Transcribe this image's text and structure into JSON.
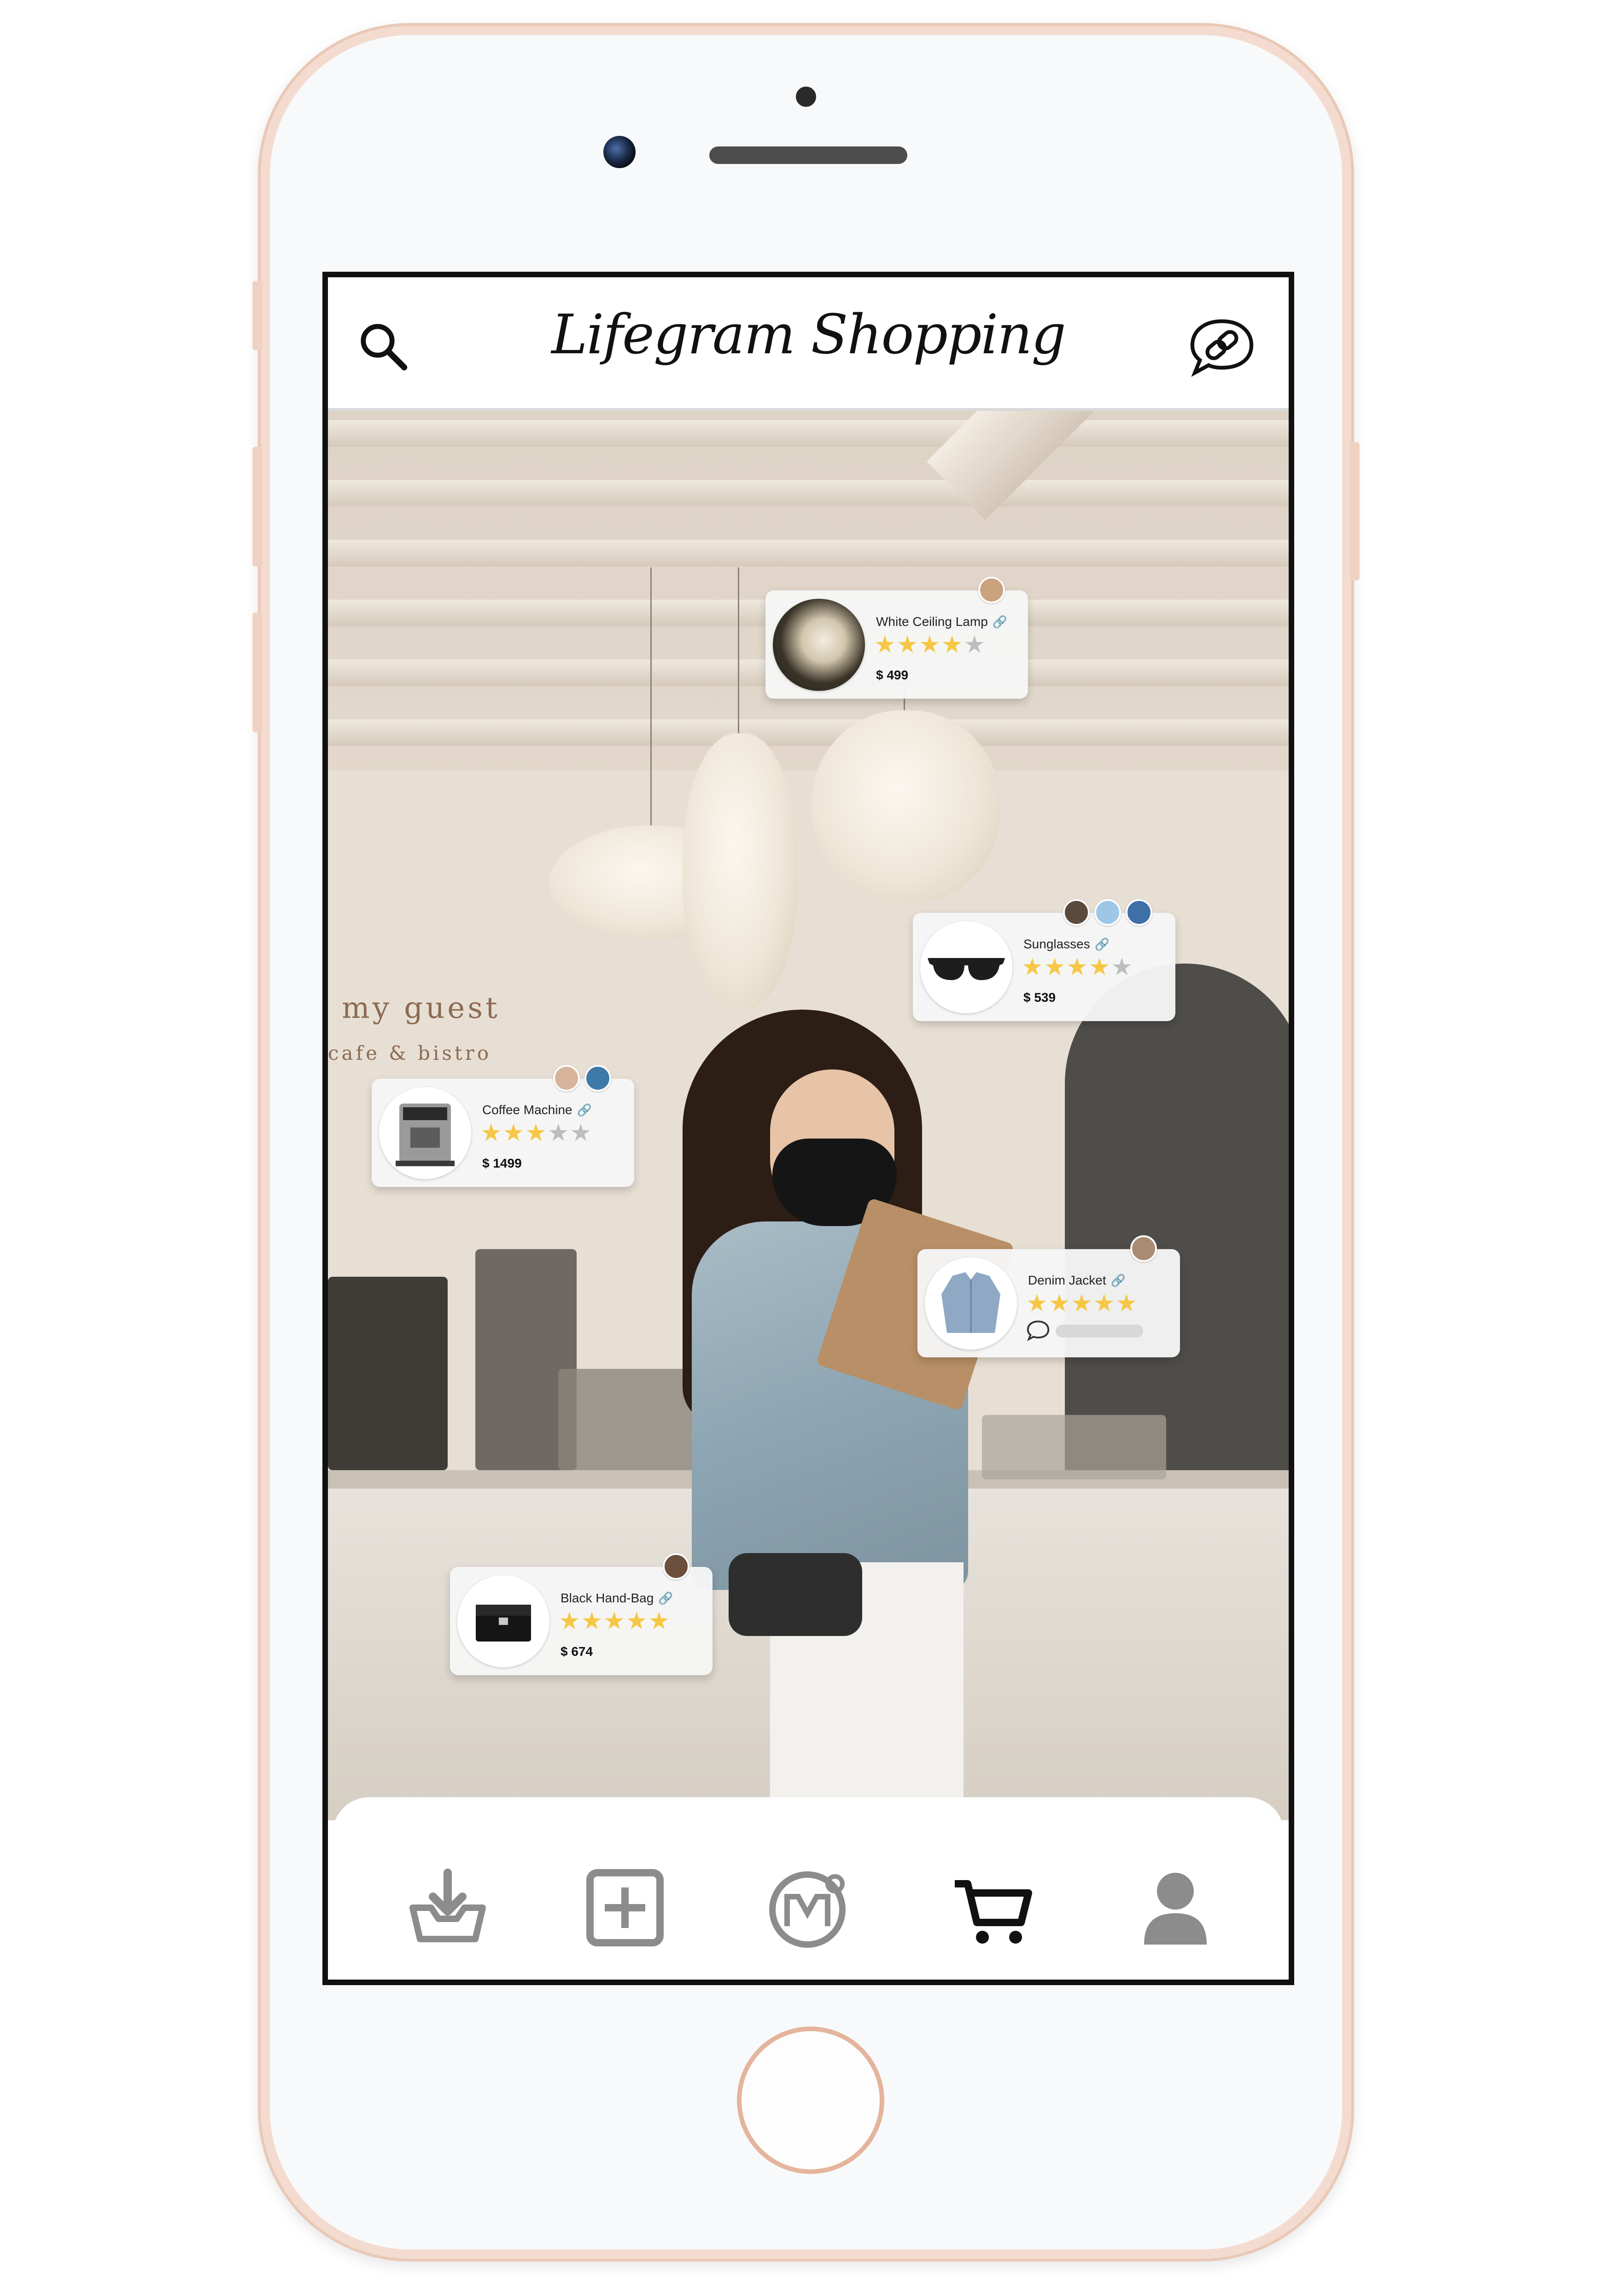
{
  "app": {
    "title": "Lifegram Shopping"
  },
  "header": {
    "search_icon": "search-icon",
    "chat_link_icon": "chat-link-icon"
  },
  "photo_overlay": {
    "wall_text_main": "my guest",
    "wall_text_sub": "cafe & bistro"
  },
  "products": [
    {
      "name": "White Ceiling Lamp",
      "price": "$ 499",
      "rating": 4,
      "rating_max": 5,
      "stars_on": "★★★★",
      "stars_off": "★",
      "link_icon": "link-icon",
      "avatars": [
        "#caa27e"
      ]
    },
    {
      "name": "Sunglasses",
      "price": "$ 539",
      "rating": 4,
      "rating_max": 5,
      "stars_on": "★★★★",
      "stars_off": "★",
      "link_icon": "link-icon",
      "avatars": [
        "#5a4a3e",
        "#9ec6e6",
        "#3e6fa6"
      ]
    },
    {
      "name": "Coffee Machine",
      "price": "$ 1499",
      "rating": 3,
      "rating_max": 5,
      "stars_on": "★★★",
      "stars_off": "★★",
      "link_icon": "link-icon",
      "avatars": [
        "#d6b39a",
        "#3f79a8"
      ]
    },
    {
      "name": "Denim Jacket",
      "price": "",
      "rating": 5,
      "rating_max": 5,
      "stars_on": "★★★★★",
      "stars_off": "",
      "link_icon": "link-icon",
      "avatars": [
        "#a98b74"
      ]
    },
    {
      "name": "Black Hand-Bag",
      "price": "$ 674",
      "rating": 5,
      "rating_max": 5,
      "stars_on": "★★★★★",
      "stars_off": "",
      "link_icon": "link-icon",
      "avatars": [
        "#6d4f3d"
      ]
    }
  ],
  "colors": {
    "star_on": "#f6c744",
    "star_off": "#bdbdbd",
    "nav_inactive": "#8c8c8c",
    "nav_active": "#111111",
    "phone_frame": "#f3dccf"
  },
  "bottom_nav": [
    {
      "icon": "download-tray-icon",
      "active": false
    },
    {
      "icon": "add-square-icon",
      "active": false
    },
    {
      "icon": "brand-m-icon",
      "active": false
    },
    {
      "icon": "cart-icon",
      "active": true
    },
    {
      "icon": "profile-icon",
      "active": false
    }
  ]
}
